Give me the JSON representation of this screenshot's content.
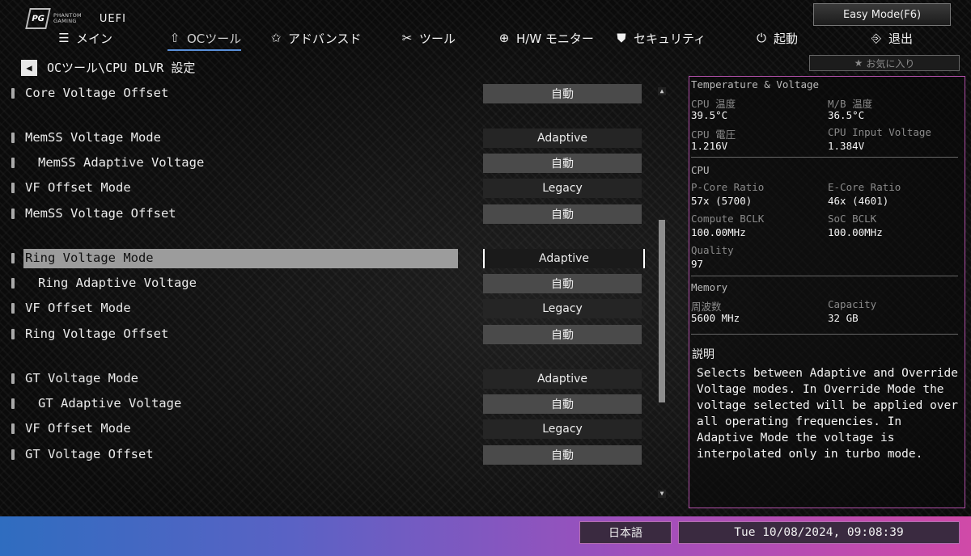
{
  "header": {
    "logo_line1": "PHANTOM",
    "logo_line2": "GAMING",
    "uefi_label": "UEFI",
    "easy_mode_label": "Easy Mode(F6)"
  },
  "nav": {
    "items": [
      {
        "label": "メイン",
        "icon": "list-icon"
      },
      {
        "label": "OCツール",
        "icon": "rocket-icon"
      },
      {
        "label": "アドバンスド",
        "icon": "star-icon"
      },
      {
        "label": "ツール",
        "icon": "tools-icon"
      },
      {
        "label": "H/W モニター",
        "icon": "crosshair-icon"
      },
      {
        "label": "セキュリティ",
        "icon": "shield-icon"
      },
      {
        "label": "起動",
        "icon": "power-icon"
      },
      {
        "label": "退出",
        "icon": "exit-icon"
      }
    ],
    "active_index": 1
  },
  "breadcrumb": {
    "path": "OCツール\\CPU DLVR 設定"
  },
  "settings": [
    {
      "label": "Core Voltage Offset",
      "value": "自動"
    },
    {
      "label": "MemSS Voltage Mode",
      "value": "Adaptive"
    },
    {
      "label": "MemSS Adaptive Voltage",
      "value": "自動"
    },
    {
      "label": "VF Offset Mode",
      "value": "Legacy"
    },
    {
      "label": "MemSS Voltage Offset",
      "value": "自動"
    },
    {
      "label": "Ring Voltage Mode",
      "value": "Adaptive"
    },
    {
      "label": "Ring Adaptive Voltage",
      "value": "自動"
    },
    {
      "label": "VF Offset Mode",
      "value": "Legacy"
    },
    {
      "label": "Ring Voltage Offset",
      "value": "自動"
    },
    {
      "label": "GT Voltage Mode",
      "value": "Adaptive"
    },
    {
      "label": "GT Adaptive Voltage",
      "value": "自動"
    },
    {
      "label": "VF Offset Mode",
      "value": "Legacy"
    },
    {
      "label": "GT Voltage Offset",
      "value": "自動"
    }
  ],
  "favorites": {
    "label": "お気に入り"
  },
  "hw_monitor": {
    "temp_voltage_title": "Temperature & Voltage",
    "cpu_temp_label": "CPU 温度",
    "cpu_temp_value": "39.5°C",
    "mb_temp_label": "M/B 温度",
    "mb_temp_value": "36.5°C",
    "cpu_voltage_label": "CPU 電圧",
    "cpu_voltage_value": "1.216V",
    "cpu_input_voltage_label": "CPU Input Voltage",
    "cpu_input_voltage_value": "1.384V",
    "cpu_title": "CPU",
    "pcore_ratio_label": "P-Core Ratio",
    "pcore_ratio_value": "57x (5700)",
    "ecore_ratio_label": "E-Core Ratio",
    "ecore_ratio_value": "46x (4601)",
    "compute_bclk_label": "Compute BCLK",
    "compute_bclk_value": "100.00MHz",
    "soc_bclk_label": "SoC BCLK",
    "soc_bclk_value": "100.00MHz",
    "quality_label": "Quality",
    "quality_value": "97",
    "memory_title": "Memory",
    "frequency_label": "周波数",
    "frequency_value": "5600 MHz",
    "capacity_label": "Capacity",
    "capacity_value": "32 GB"
  },
  "description": {
    "title": "説明",
    "text": "Selects between Adaptive and Override Voltage modes. In Override Mode the voltage selected will be applied over all operating frequencies. In Adaptive Mode the voltage is interpolated only in turbo mode."
  },
  "footer": {
    "language": "日本語",
    "datetime": "Tue 10/08/2024, 09:08:39"
  },
  "colors": {
    "accent_blue": "#5a8fd8",
    "panel_border": "#b04fa8",
    "footer_start": "#2f6dc0",
    "footer_end": "#d04aa8"
  }
}
